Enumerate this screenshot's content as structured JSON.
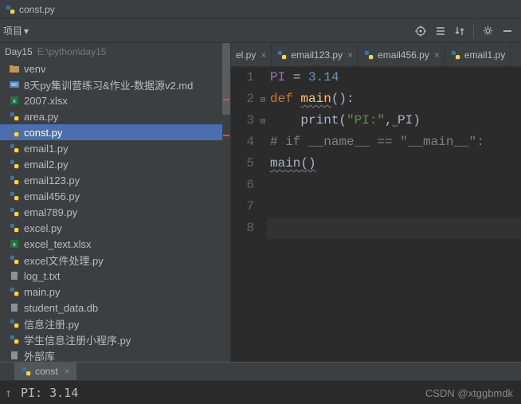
{
  "titlebar": {
    "filename": "const.py"
  },
  "toolbar": {
    "projectLabel": "项目"
  },
  "breadcrumb": {
    "root": "Day15",
    "path": "E:\\python\\day15"
  },
  "tree": [
    {
      "name": "venv",
      "type": "folder"
    },
    {
      "name": "8天py集训营练习&作业-数据源v2.md",
      "type": "md"
    },
    {
      "name": "2007.xlsx",
      "type": "xlsx"
    },
    {
      "name": "area.py",
      "type": "py"
    },
    {
      "name": "const.py",
      "type": "py",
      "selected": true
    },
    {
      "name": "email1.py",
      "type": "py"
    },
    {
      "name": "email2.py",
      "type": "py"
    },
    {
      "name": "email123.py",
      "type": "py"
    },
    {
      "name": "email456.py",
      "type": "py"
    },
    {
      "name": "emal789.py",
      "type": "py"
    },
    {
      "name": "excel.py",
      "type": "py"
    },
    {
      "name": "excel_text.xlsx",
      "type": "xlsx"
    },
    {
      "name": "excel文件处理.py",
      "type": "py"
    },
    {
      "name": "log_t.txt",
      "type": "txt"
    },
    {
      "name": "main.py",
      "type": "py"
    },
    {
      "name": "student_data.db",
      "type": "db"
    },
    {
      "name": "信息注册.py",
      "type": "py"
    },
    {
      "name": "学生信息注册小程序.py",
      "type": "py"
    },
    {
      "name": "外部库",
      "type": "lib"
    }
  ],
  "tabs": [
    {
      "label": "el.py",
      "partial": true
    },
    {
      "label": "email123.py"
    },
    {
      "label": "email456.py"
    },
    {
      "label": "email1.py",
      "partial": true
    }
  ],
  "code": {
    "lines": [
      {
        "n": 1,
        "tokens": [
          [
            "var",
            "PI"
          ],
          [
            "txt",
            " = "
          ],
          [
            "num",
            "3.14"
          ]
        ]
      },
      {
        "n": 2,
        "tokens": [
          [
            "kw",
            "def"
          ],
          [
            "txt",
            " "
          ],
          [
            "fn",
            "main"
          ],
          [
            "txt",
            "():"
          ]
        ]
      },
      {
        "n": 3,
        "tokens": [
          [
            "txt",
            "    "
          ],
          [
            "fn",
            "print"
          ],
          [
            "txt",
            "("
          ],
          [
            "str",
            "\"PI:\""
          ],
          [
            "txt",
            ","
          ],
          [
            "com",
            "."
          ],
          [
            "txt",
            "PI)"
          ]
        ]
      },
      {
        "n": 4,
        "tokens": [
          [
            "com",
            "# if __name__ == \"__main__\":"
          ]
        ]
      },
      {
        "n": 5,
        "tokens": [
          [
            "txt",
            "main()"
          ]
        ]
      },
      {
        "n": 6,
        "tokens": []
      },
      {
        "n": 7,
        "tokens": []
      },
      {
        "n": 8,
        "tokens": [],
        "cursor": true
      }
    ]
  },
  "runTab": {
    "label": "const"
  },
  "console": {
    "output": "PI: 3.14"
  },
  "watermark": "CSDN @xtggbmdk"
}
